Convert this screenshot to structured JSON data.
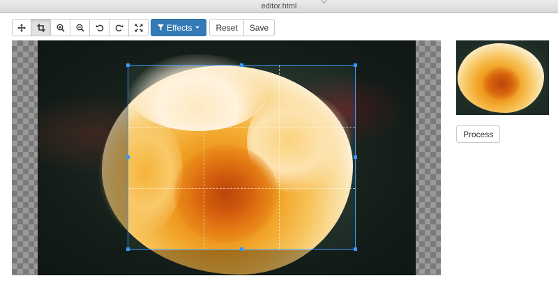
{
  "window": {
    "title": "editor.html"
  },
  "toolbar": {
    "tools": [
      {
        "name": "move-icon",
        "active": false
      },
      {
        "name": "crop-icon",
        "active": true
      },
      {
        "name": "zoom-in-icon",
        "active": false
      },
      {
        "name": "zoom-out-icon",
        "active": false
      },
      {
        "name": "rotate-left-icon",
        "active": false
      },
      {
        "name": "rotate-right-icon",
        "active": false
      },
      {
        "name": "fullscreen-icon",
        "active": false
      }
    ],
    "effects_label": "Effects",
    "effects_icon": "filter-icon",
    "reset_label": "Reset",
    "save_label": "Save"
  },
  "sidebar": {
    "process_label": "Process"
  },
  "colors": {
    "accent": "#337ab7",
    "crop_border": "#3399ff"
  }
}
